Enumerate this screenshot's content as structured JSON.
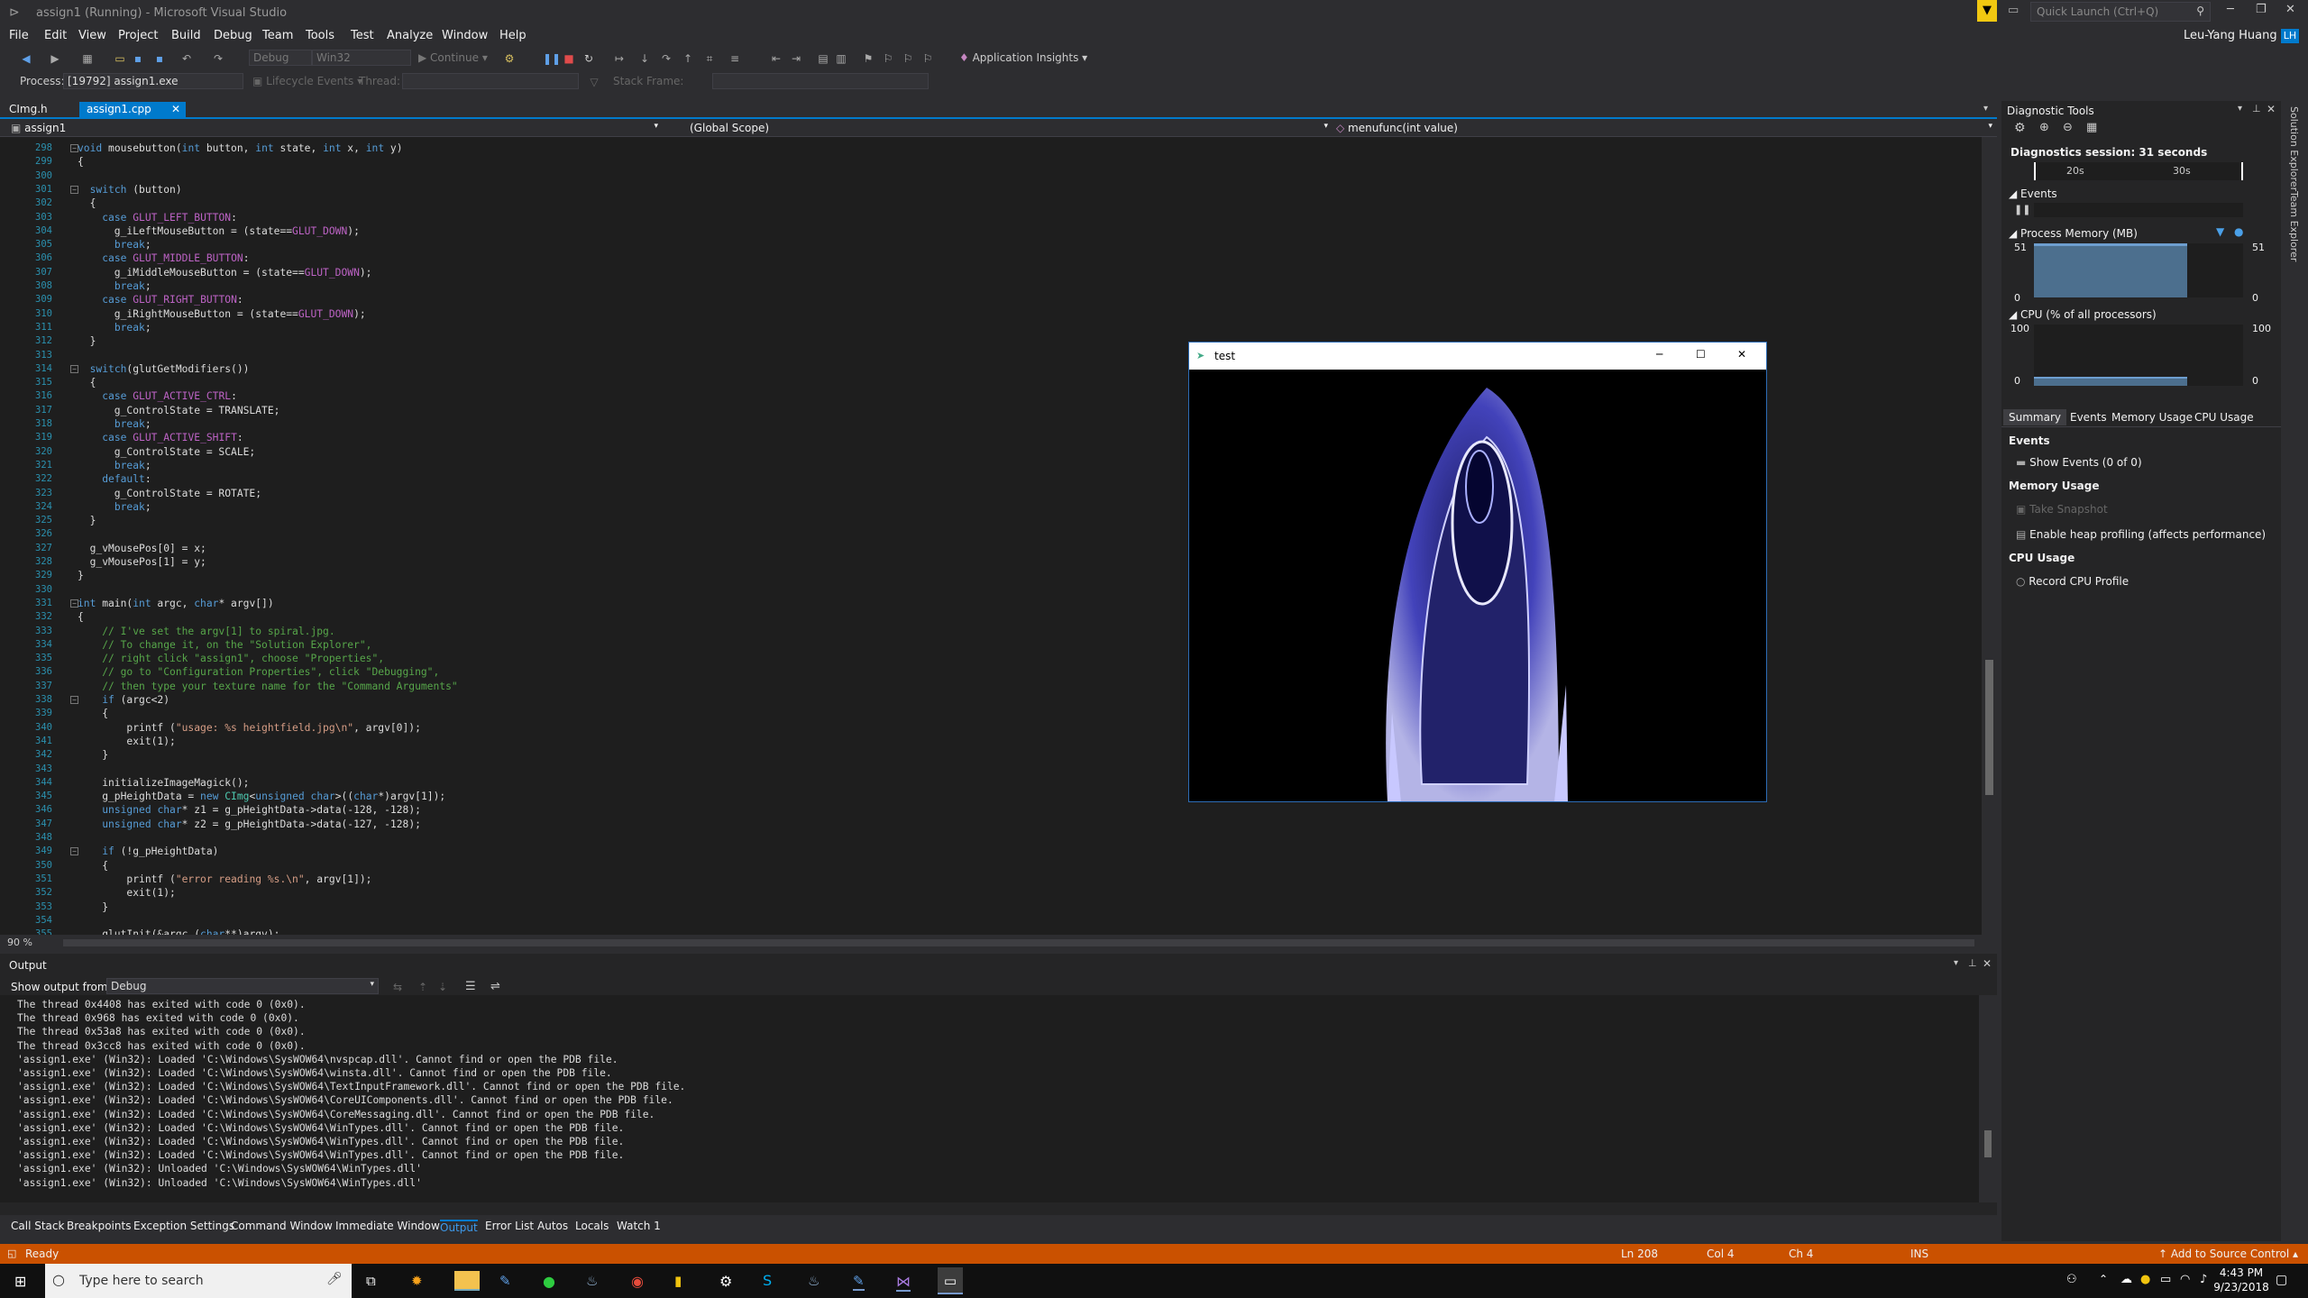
{
  "window_title": "assign1 (Running) - Microsoft Visual Studio",
  "menu": [
    "File",
    "Edit",
    "View",
    "Project",
    "Build",
    "Debug",
    "Team",
    "Tools",
    "Test",
    "Analyze",
    "Window",
    "Help"
  ],
  "quick_launch_placeholder": "Quick Launch (Ctrl+Q)",
  "user_name": "Leu-Yang Huang",
  "user_initials": "LH",
  "toolbar": {
    "config": "Debug",
    "platform": "Win32",
    "continue": "Continue",
    "app_insights": "Application Insights"
  },
  "debug_bar": {
    "process_label": "Process:",
    "process_value": "[19792] assign1.exe",
    "lifecycle": "Lifecycle Events",
    "thread_label": "Thread:",
    "stack_frame_label": "Stack Frame:"
  },
  "tabs": [
    {
      "label": "CImg.h"
    },
    {
      "label": "assign1.cpp"
    }
  ],
  "navbar": {
    "project": "assign1",
    "scope": "(Global Scope)",
    "member": "menufunc(int value)"
  },
  "zoom": "90 %",
  "code_lines": [
    {
      "n": "298",
      "t": "void mousebutton(int button, int state, int x, int y)"
    },
    {
      "n": "299",
      "t": "{"
    },
    {
      "n": "300",
      "t": ""
    },
    {
      "n": "301",
      "t": "  switch (button)"
    },
    {
      "n": "302",
      "t": "  {"
    },
    {
      "n": "303",
      "t": "    case GLUT_LEFT_BUTTON:"
    },
    {
      "n": "304",
      "t": "      g_iLeftMouseButton = (state==GLUT_DOWN);"
    },
    {
      "n": "305",
      "t": "      break;"
    },
    {
      "n": "306",
      "t": "    case GLUT_MIDDLE_BUTTON:"
    },
    {
      "n": "307",
      "t": "      g_iMiddleMouseButton = (state==GLUT_DOWN);"
    },
    {
      "n": "308",
      "t": "      break;"
    },
    {
      "n": "309",
      "t": "    case GLUT_RIGHT_BUTTON:"
    },
    {
      "n": "310",
      "t": "      g_iRightMouseButton = (state==GLUT_DOWN);"
    },
    {
      "n": "311",
      "t": "      break;"
    },
    {
      "n": "312",
      "t": "  }"
    },
    {
      "n": "313",
      "t": ""
    },
    {
      "n": "314",
      "t": "  switch(glutGetModifiers())"
    },
    {
      "n": "315",
      "t": "  {"
    },
    {
      "n": "316",
      "t": "    case GLUT_ACTIVE_CTRL:"
    },
    {
      "n": "317",
      "t": "      g_ControlState = TRANSLATE;"
    },
    {
      "n": "318",
      "t": "      break;"
    },
    {
      "n": "319",
      "t": "    case GLUT_ACTIVE_SHIFT:"
    },
    {
      "n": "320",
      "t": "      g_ControlState = SCALE;"
    },
    {
      "n": "321",
      "t": "      break;"
    },
    {
      "n": "322",
      "t": "    default:"
    },
    {
      "n": "323",
      "t": "      g_ControlState = ROTATE;"
    },
    {
      "n": "324",
      "t": "      break;"
    },
    {
      "n": "325",
      "t": "  }"
    },
    {
      "n": "326",
      "t": ""
    },
    {
      "n": "327",
      "t": "  g_vMousePos[0] = x;"
    },
    {
      "n": "328",
      "t": "  g_vMousePos[1] = y;"
    },
    {
      "n": "329",
      "t": "}"
    },
    {
      "n": "330",
      "t": ""
    },
    {
      "n": "331",
      "t": "int main(int argc, char* argv[])"
    },
    {
      "n": "332",
      "t": "{"
    },
    {
      "n": "333",
      "t": "    // I've set the argv[1] to spiral.jpg."
    },
    {
      "n": "334",
      "t": "    // To change it, on the \"Solution Explorer\","
    },
    {
      "n": "335",
      "t": "    // right click \"assign1\", choose \"Properties\","
    },
    {
      "n": "336",
      "t": "    // go to \"Configuration Properties\", click \"Debugging\","
    },
    {
      "n": "337",
      "t": "    // then type your texture name for the \"Command Arguments\""
    },
    {
      "n": "338",
      "t": "    if (argc<2)"
    },
    {
      "n": "339",
      "t": "    {"
    },
    {
      "n": "340",
      "t": "        printf (\"usage: %s heightfield.jpg\\n\", argv[0]);"
    },
    {
      "n": "341",
      "t": "        exit(1);"
    },
    {
      "n": "342",
      "t": "    }"
    },
    {
      "n": "343",
      "t": ""
    },
    {
      "n": "344",
      "t": "    initializeImageMagick();"
    },
    {
      "n": "345",
      "t": "    g_pHeightData = new CImg<unsigned char>((char*)argv[1]);"
    },
    {
      "n": "346",
      "t": "    unsigned char* z1 = g_pHeightData->data(-128, -128);"
    },
    {
      "n": "347",
      "t": "    unsigned char* z2 = g_pHeightData->data(-127, -128);"
    },
    {
      "n": "348",
      "t": ""
    },
    {
      "n": "349",
      "t": "    if (!g_pHeightData)"
    },
    {
      "n": "350",
      "t": "    {"
    },
    {
      "n": "351",
      "t": "        printf (\"error reading %s.\\n\", argv[1]);"
    },
    {
      "n": "352",
      "t": "        exit(1);"
    },
    {
      "n": "353",
      "t": "    }"
    },
    {
      "n": "354",
      "t": ""
    },
    {
      "n": "355",
      "t": "    glutInit(&argc,(char**)argv);"
    }
  ],
  "output": {
    "title": "Output",
    "show_from_label": "Show output from:",
    "show_from_value": "Debug",
    "lines": [
      "The thread 0x4408 has exited with code 0 (0x0).",
      "The thread 0x968 has exited with code 0 (0x0).",
      "The thread 0x53a8 has exited with code 0 (0x0).",
      "The thread 0x3cc8 has exited with code 0 (0x0).",
      "'assign1.exe' (Win32): Loaded 'C:\\Windows\\SysWOW64\\nvspcap.dll'. Cannot find or open the PDB file.",
      "'assign1.exe' (Win32): Loaded 'C:\\Windows\\SysWOW64\\winsta.dll'. Cannot find or open the PDB file.",
      "'assign1.exe' (Win32): Loaded 'C:\\Windows\\SysWOW64\\TextInputFramework.dll'. Cannot find or open the PDB file.",
      "'assign1.exe' (Win32): Loaded 'C:\\Windows\\SysWOW64\\CoreUIComponents.dll'. Cannot find or open the PDB file.",
      "'assign1.exe' (Win32): Loaded 'C:\\Windows\\SysWOW64\\CoreMessaging.dll'. Cannot find or open the PDB file.",
      "'assign1.exe' (Win32): Loaded 'C:\\Windows\\SysWOW64\\WinTypes.dll'. Cannot find or open the PDB file.",
      "'assign1.exe' (Win32): Loaded 'C:\\Windows\\SysWOW64\\WinTypes.dll'. Cannot find or open the PDB file.",
      "'assign1.exe' (Win32): Loaded 'C:\\Windows\\SysWOW64\\WinTypes.dll'. Cannot find or open the PDB file.",
      "'assign1.exe' (Win32): Unloaded 'C:\\Windows\\SysWOW64\\WinTypes.dll'",
      "'assign1.exe' (Win32): Unloaded 'C:\\Windows\\SysWOW64\\WinTypes.dll'"
    ]
  },
  "bottom_tabs": [
    "Call Stack",
    "Breakpoints",
    "Exception Settings",
    "Command Window",
    "Immediate Window",
    "Output",
    "Error List",
    "Autos",
    "Locals",
    "Watch 1"
  ],
  "diagnostics": {
    "title": "Diagnostic Tools",
    "session": "Diagnostics session: 31 seconds",
    "timeline_ticks": [
      "20s",
      "30s"
    ],
    "events_header": "Events",
    "memory_header": "Process Memory (MB)",
    "memory_max": "51",
    "memory_min": "0",
    "cpu_header": "CPU (% of all processors)",
    "cpu_max": "100",
    "cpu_min": "0",
    "tabs": [
      "Summary",
      "Events",
      "Memory Usage",
      "CPU Usage"
    ],
    "sec_events": "Events",
    "show_events": "Show Events (0 of 0)",
    "sec_memory": "Memory Usage",
    "take_snapshot": "Take Snapshot",
    "heap_profiling": "Enable heap profiling (affects performance)",
    "sec_cpu": "CPU Usage",
    "record_cpu": "Record CPU Profile"
  },
  "right_strip": [
    "Solution Explorer",
    "Team Explorer"
  ],
  "popup": {
    "title": "test"
  },
  "status": {
    "ready": "Ready",
    "ln": "Ln 208",
    "col": "Col 4",
    "ch": "Ch 4",
    "ins": "INS",
    "source_control": "Add to Source Control"
  },
  "taskbar": {
    "search_placeholder": "Type here to search",
    "time": "4:43 PM",
    "date": "9/23/2018"
  },
  "colors": {
    "accent": "#007acc",
    "status": "#ca5100",
    "editor_bg": "#1e1e1e"
  }
}
